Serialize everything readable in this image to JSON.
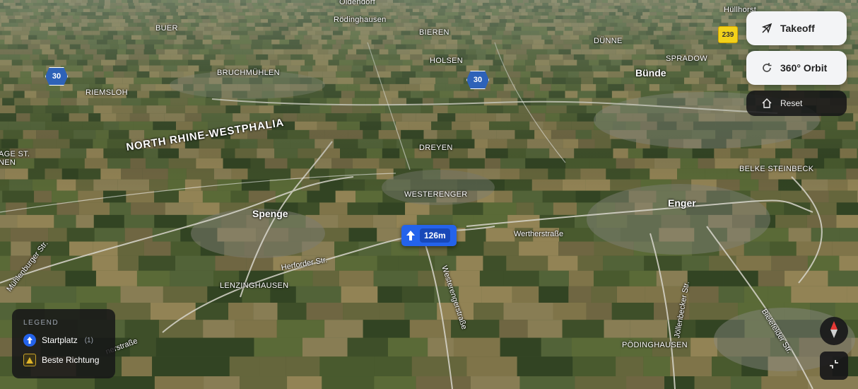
{
  "map": {
    "places_small": [
      {
        "name": "Oldendorf"
      },
      {
        "name": "BUER"
      },
      {
        "name": "Rödinghausen"
      },
      {
        "name": "BIEREN"
      },
      {
        "name": "DÜNNE"
      },
      {
        "name": "Hüllhorst"
      },
      {
        "name": "HOLSEN"
      },
      {
        "name": "SPRADOW"
      },
      {
        "name": "BRUCHMÜHLEN"
      },
      {
        "name": "RIEMSLOH"
      },
      {
        "name": "AGE ST."
      },
      {
        "name": "NEN"
      },
      {
        "name": "DREYEN"
      },
      {
        "name": "BELKE STEINBECK"
      },
      {
        "name": "WESTERENGER"
      },
      {
        "name": "LENZINGHAUSEN"
      },
      {
        "name": "PÖDINGHAUSEN"
      }
    ],
    "towns": [
      {
        "name": "Bünde"
      },
      {
        "name": "Spenge"
      },
      {
        "name": "Enger"
      }
    ],
    "region": "NORTH RHINE-WESTPHALIA",
    "streets": [
      {
        "name": "Mühlenburger Str."
      },
      {
        "name": "Herforder Str."
      },
      {
        "name": "Westerengerstraße"
      },
      {
        "name": "Wertherstraße"
      },
      {
        "name": "Jöllenbecker Str."
      },
      {
        "name": "Bielefelder Str."
      },
      {
        "name": "nerstraße"
      }
    ],
    "road_shields": [
      {
        "number": "30"
      },
      {
        "number": "30"
      }
    ],
    "yellow_shield": "239"
  },
  "marker": {
    "altitude": "126m",
    "icon": "arrow-up-icon",
    "color": "#2463eb"
  },
  "controls": {
    "takeoff_label": "Takeoff",
    "takeoff_icon": "plane-icon",
    "orbit_label": "360° Orbit",
    "orbit_icon": "rotate-icon",
    "reset_label": "Reset",
    "reset_icon": "home-icon"
  },
  "legend": {
    "title": "LEGEND",
    "items": [
      {
        "label": "Startplatz",
        "count": "(1)",
        "icon": "blue-circle-arrow-icon"
      },
      {
        "label": "Beste Richtung",
        "icon": "yellow-triangle-icon"
      }
    ]
  },
  "colors": {
    "accent": "#2463eb",
    "compass_north": "#e53935"
  }
}
